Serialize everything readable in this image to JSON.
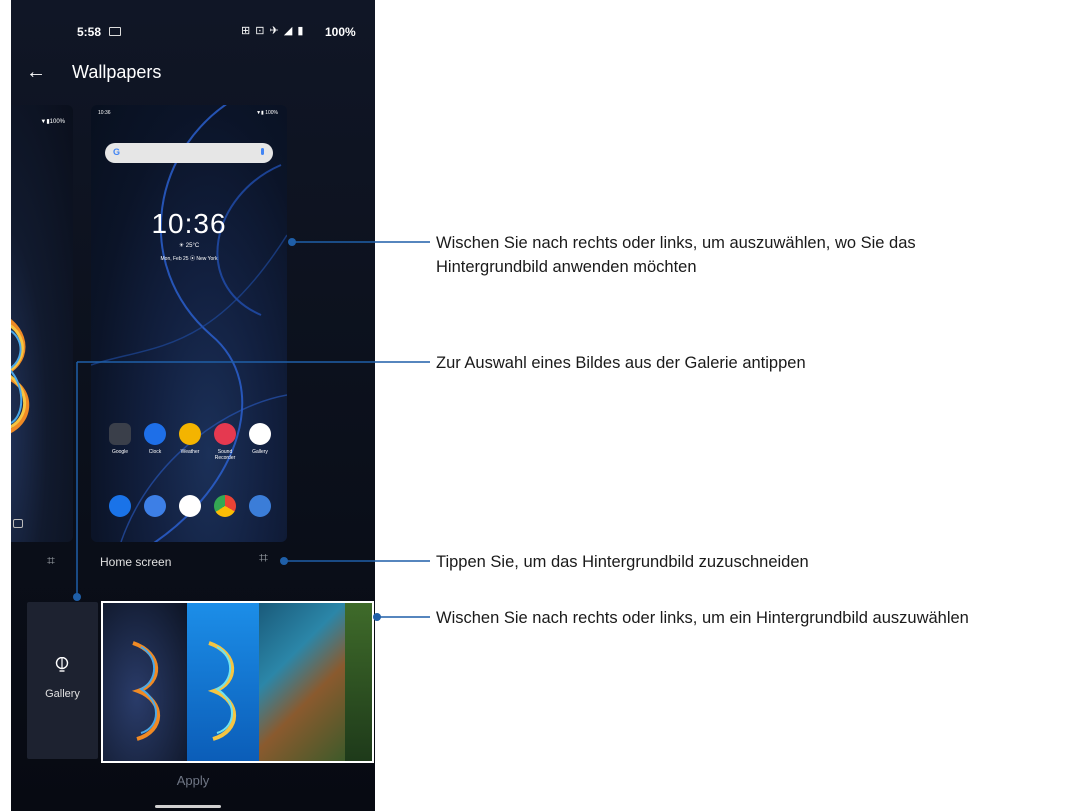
{
  "status_bar": {
    "time": "5:58",
    "icons": "⊞ ⊡ ✈ ◢ ▮",
    "battery": "100%"
  },
  "app_bar": {
    "back_icon": "arrow-left-icon",
    "title": "Wallpapers"
  },
  "preview_left": {
    "battery": "▼▮100%"
  },
  "preview_main": {
    "time": "10:36",
    "status": "▼▮ 100%",
    "search_logo": "G",
    "clock": "10:36",
    "temperature": "☀ 25°C",
    "date_location": "Mon, Feb 25  ⦿ New York",
    "apps": [
      {
        "label": "Google",
        "color": "#3a3f4a"
      },
      {
        "label": "Clock",
        "color": "#1e6fe8"
      },
      {
        "label": "Weather",
        "color": "#f4b400"
      },
      {
        "label": "Sound\nRecorder",
        "color": "#e53950"
      },
      {
        "label": "Gallery",
        "color": "#ffffff"
      }
    ],
    "dock_colors": [
      "#1a73e8",
      "#3d7fe6",
      "#ffffff",
      "#ffffff",
      "#3b7dd8"
    ]
  },
  "labels": {
    "home_screen": "Home screen",
    "gallery": "Gallery",
    "apply": "Apply"
  },
  "callouts": {
    "swipe_apply_line1": "Wischen Sie nach rechts oder links, um auszuwählen, wo Sie das",
    "swipe_apply_line2": "Hintergrundbild anwenden möchten",
    "gallery_tap": "Zur Auswahl eines Bildes aus der Galerie antippen",
    "crop_tap": "Tippen Sie, um das Hintergrundbild zuzuschneiden",
    "swipe_select": "Wischen Sie nach rechts oder links, um ein Hintergrundbild auszuwählen"
  },
  "colors": {
    "accent_line": "#1f5fa8",
    "phone_bg": "#0c111d"
  }
}
